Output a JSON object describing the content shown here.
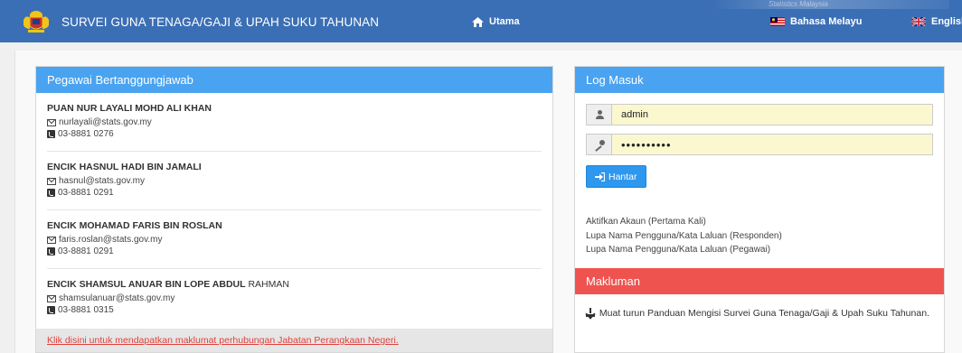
{
  "header": {
    "app_title": "SURVEI GUNA TENAGA/GAJI & UPAH SUKU TAHUNAN",
    "home_label": "Utama",
    "lang_ms": "Bahasa Melayu",
    "lang_en": "English",
    "banner_text": "Statistics Malaysia",
    "icons": {
      "logo": "coat-of-arms-logo",
      "home": "home-icon",
      "flag_ms": "malaysia-flag-icon",
      "flag_en": "uk-flag-icon"
    },
    "colors": {
      "navbar": "#3b6fb5"
    }
  },
  "officers": {
    "heading": "Pegawai Bertanggungjawab",
    "list": [
      {
        "name": "PUAN NUR LAYALI MOHD ALI KHAN",
        "name_suffix": "",
        "email": "nurlayali@stats.gov.my",
        "phone": "03-8881 0276"
      },
      {
        "name": "ENCIK HASNUL HADI BIN JAMALI",
        "name_suffix": "",
        "email": "hasnul@stats.gov.my",
        "phone": "03-8881 0291"
      },
      {
        "name": "ENCIK MOHAMAD FARIS BIN ROSLAN",
        "name_suffix": "",
        "email": "faris.roslan@stats.gov.my",
        "phone": "03-8881 0291"
      },
      {
        "name": "ENCIK SHAMSUL ANUAR BIN LOPE ABDUL",
        "name_suffix": " RAHMAN",
        "email": "shamsulanuar@stats.gov.my",
        "phone": "03-8881 0315"
      }
    ],
    "footer_link": "Klik disini untuk mendapatkan maklumat perhubungan Jabatan Perangkaan Negeri."
  },
  "login": {
    "heading": "Log Masuk",
    "username_value": "admin",
    "password_value": "••••••••••",
    "submit_label": "Hantar",
    "links": [
      "Aktifkan Akaun (Pertama Kali)",
      "Lupa Nama Pengguna/Kata Laluan (Responden)",
      "Lupa Nama Pengguna/Kata Laluan (Pegawai)"
    ],
    "colors": {
      "heading": "#4aa3f0",
      "input_bg": "#fbf8cf",
      "button": "#2e97ee"
    }
  },
  "notice": {
    "heading": "Makluman",
    "prefix": "Muat turun",
    "link_text": "Panduan Mengisi Survei Guna Tenaga/Gaji & Upah Suku Tahunan.",
    "colors": {
      "heading": "#ef5350"
    }
  }
}
